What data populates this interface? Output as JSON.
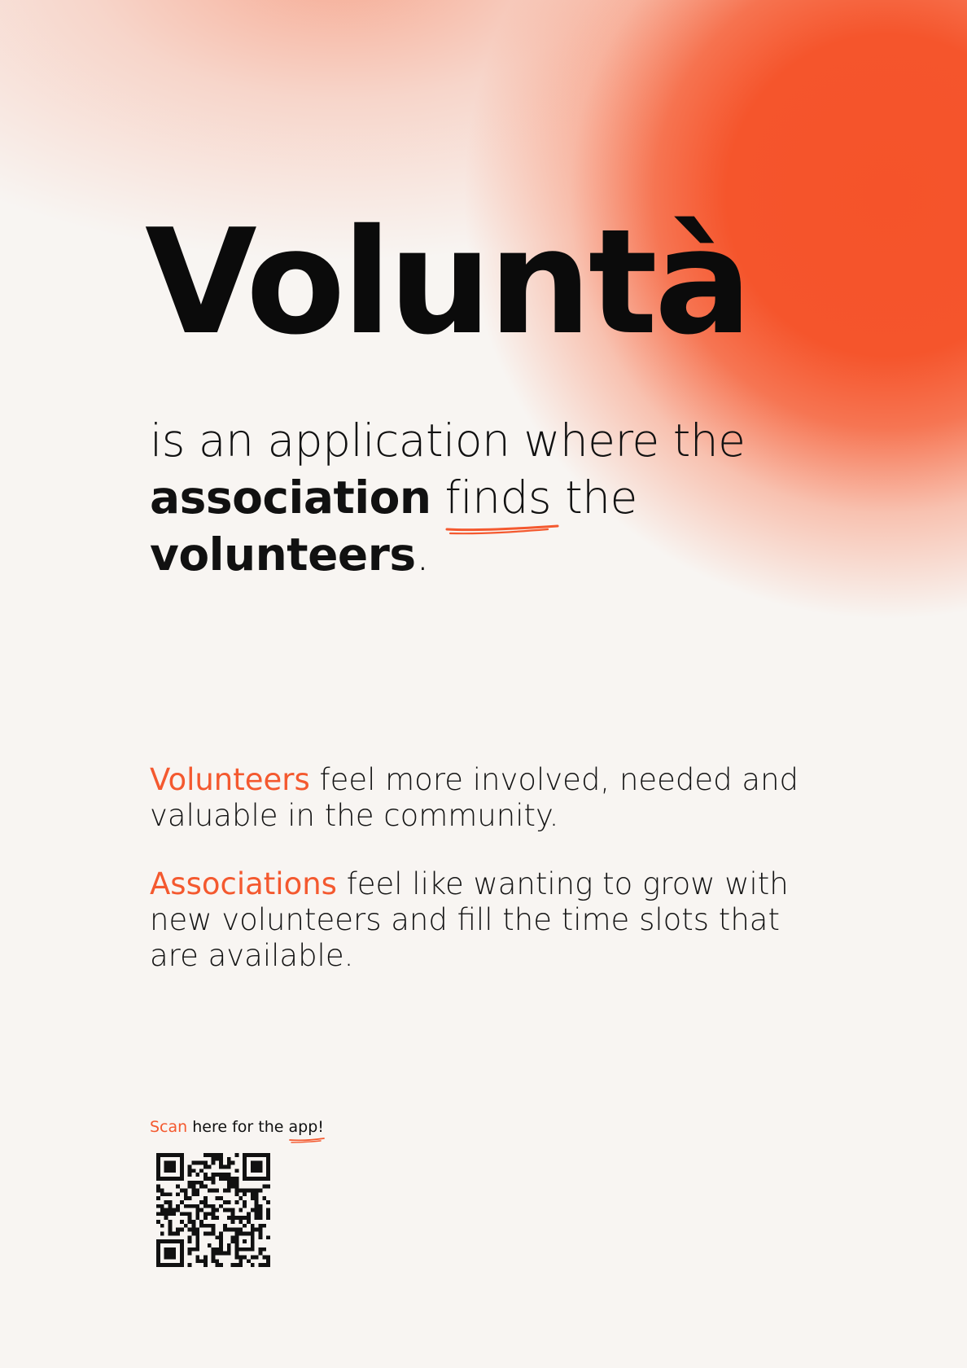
{
  "brand": {
    "title": "Voluntà",
    "accent_color": "#f4592f"
  },
  "tagline": {
    "part1": "is an application where the ",
    "bold1": "association",
    "part2": " ",
    "underlined": "finds",
    "part3": " the ",
    "bold2": "volunteers",
    "part4": "."
  },
  "paragraphs": [
    {
      "accent": "Volunteers",
      "text": " feel more involved, needed and valuable in the community."
    },
    {
      "accent": "Associations",
      "text": " feel like wanting to grow with new volunteers and fill the time slots that are available."
    }
  ],
  "scan": {
    "accent": "Scan",
    "text": " here for the ",
    "link": "app!",
    "qr_icon": "qr-code-icon"
  }
}
